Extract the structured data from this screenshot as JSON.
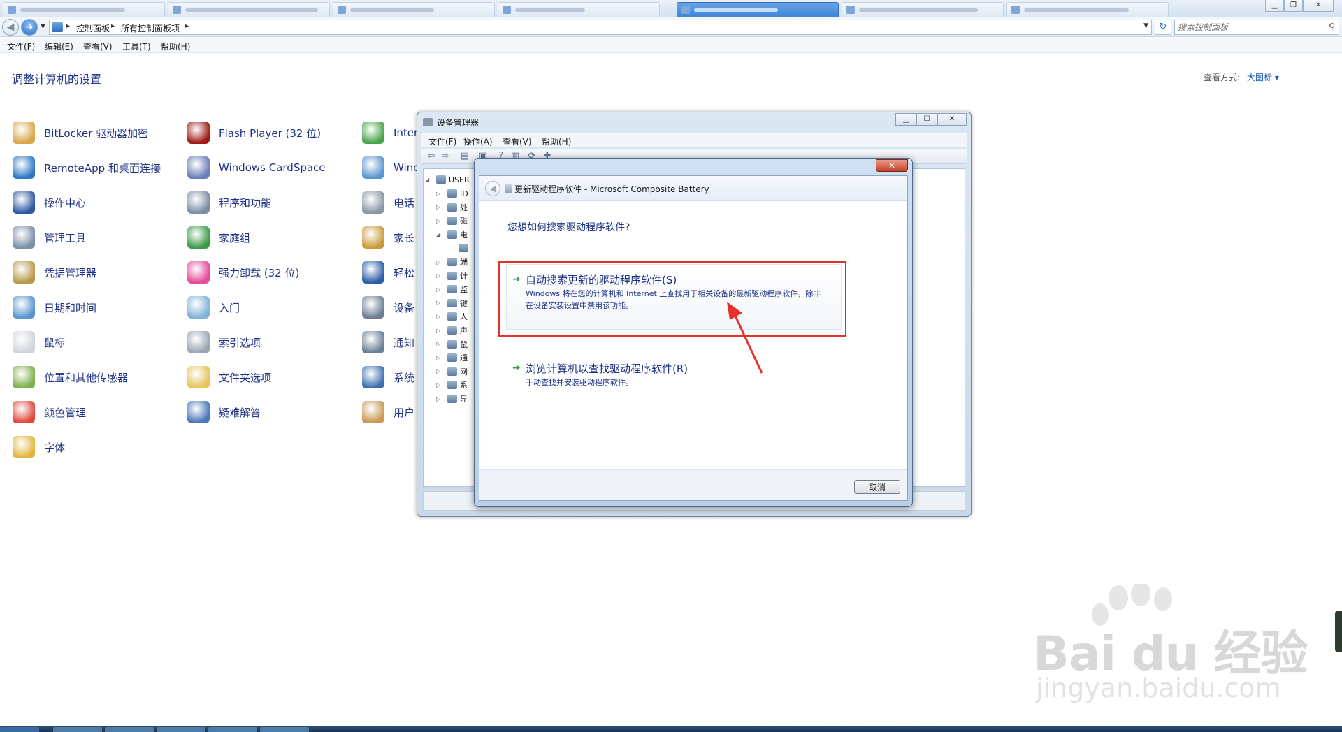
{
  "address_bar": {
    "crumbs": [
      "控制面板",
      "所有控制面板项"
    ],
    "search_placeholder": "搜索控制面板"
  },
  "menu": [
    "文件(F)",
    "编辑(E)",
    "查看(V)",
    "工具(T)",
    "帮助(H)"
  ],
  "control_panel": {
    "title": "调整计算机的设置",
    "view_by_label": "查看方式:",
    "view_by_value": "大图标 ▾",
    "columns": [
      [
        "BitLocker 驱动器加密",
        "RemoteApp 和桌面连接",
        "操作中心",
        "管理工具",
        "凭据管理器",
        "日期和时间",
        "鼠标",
        "位置和其他传感器",
        "颜色管理",
        "字体"
      ],
      [
        "Flash Player (32 位)",
        "Windows CardSpace",
        "程序和功能",
        "家庭组",
        "强力卸载 (32 位)",
        "入门",
        "索引选项",
        "文件夹选项",
        "疑难解答"
      ],
      [
        "Inter",
        "Winc",
        "电话",
        "家长",
        "轻松",
        "设备",
        "通知",
        "系统",
        "用户"
      ]
    ]
  },
  "device_manager": {
    "title": "设备管理器",
    "menu": [
      "文件(F)",
      "操作(A)",
      "查看(V)",
      "帮助(H)"
    ],
    "tree_root": "USER",
    "tree_items": [
      "ID",
      "处",
      "磁",
      "电",
      "",
      "端",
      "计",
      "监",
      "键",
      "人",
      "声",
      "鼠",
      "通",
      "网",
      "系",
      "显"
    ]
  },
  "dialog": {
    "title": "更新驱动程序软件 - Microsoft Composite Battery",
    "question": "您想如何搜索驱动程序软件?",
    "option_auto": {
      "title": "自动搜索更新的驱动程序软件(S)",
      "description": "Windows 将在您的计算机和 Internet 上查找用于相关设备的最新驱动程序软件，除非在设备安装设置中禁用该功能。"
    },
    "option_browse": {
      "title": "浏览计算机以查找驱动程序软件(R)",
      "description": "手动查找并安装驱动程序软件。"
    },
    "cancel_label": "取消"
  },
  "watermark": {
    "text": "Bai du 经验",
    "url": "jingyan.baidu.com"
  },
  "colors": {
    "link_blue": "#1e3287",
    "highlight_red": "#e5312b",
    "arrow_green": "#25a244"
  }
}
